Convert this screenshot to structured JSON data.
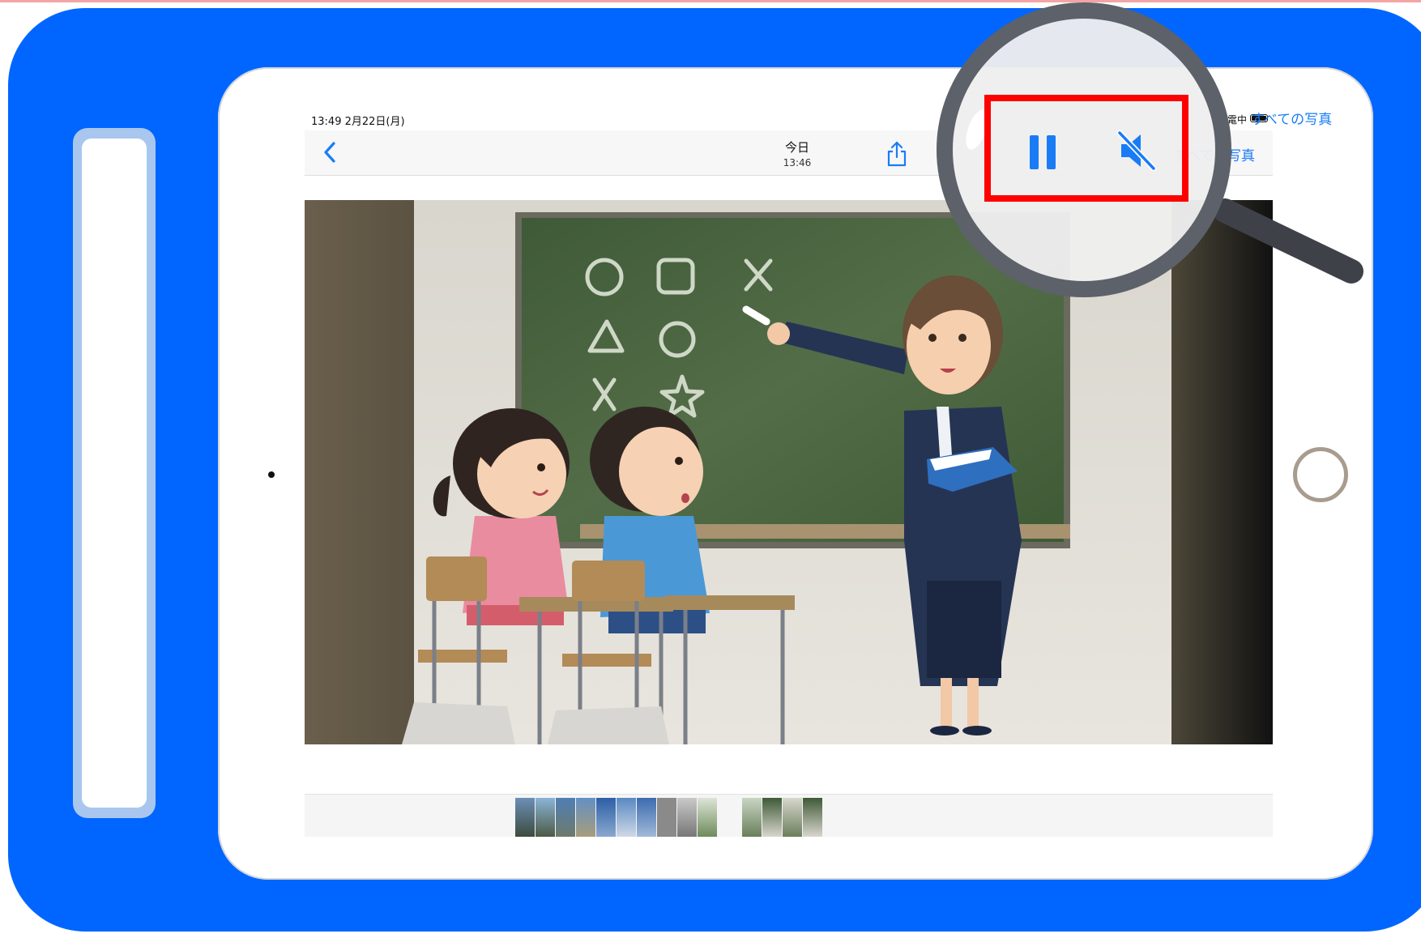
{
  "status": {
    "time_date": "13:49  2月22日(月)",
    "charging": "充電中"
  },
  "navbar": {
    "title": "今日",
    "subtitle": "13:46",
    "all_photos_label": "すべての写真"
  },
  "icons": {
    "back": "chevron-left-icon",
    "share": "share-icon",
    "undo": "undo-icon",
    "pause": "pause-icon",
    "mute": "speaker-muted-icon",
    "magnifier": "magnifying-glass-icon"
  },
  "colors": {
    "frame": "#0066ff",
    "ios_accent": "#1a7cf5",
    "highlight": "#ff0000",
    "pause_icon": "#1a7cf5"
  },
  "photo": {
    "description_shapes": [
      "○",
      "□",
      "×",
      "△",
      "○",
      "×",
      "☆"
    ]
  }
}
